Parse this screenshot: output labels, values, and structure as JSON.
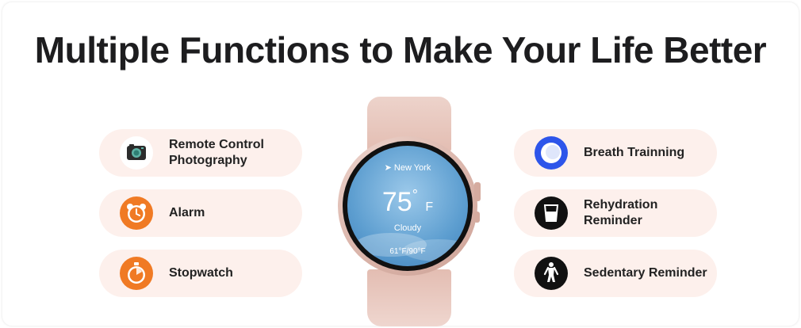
{
  "title": "Multiple Functions to Make Your Life Better",
  "left_features": [
    {
      "label": "Remote Control\nPhotography",
      "icon": "camera-icon"
    },
    {
      "label": "Alarm",
      "icon": "alarm-clock-icon"
    },
    {
      "label": "Stopwatch",
      "icon": "stopwatch-icon"
    }
  ],
  "right_features": [
    {
      "label": "Breath Trainning",
      "icon": "breath-ring-icon"
    },
    {
      "label": "Rehydration\nReminder",
      "icon": "water-glass-icon"
    },
    {
      "label": "Sedentary Reminder",
      "icon": "standing-person-icon"
    }
  ],
  "watch_face": {
    "city": "New York",
    "temperature": "75",
    "degree": "°",
    "unit": "F",
    "condition": "Cloudy",
    "range": "61°F/90°F"
  },
  "colors": {
    "pill_bg": "#fdf0ec",
    "orange": "#f07a24",
    "blue": "#2d55ea",
    "band": "#e9c8bf"
  }
}
